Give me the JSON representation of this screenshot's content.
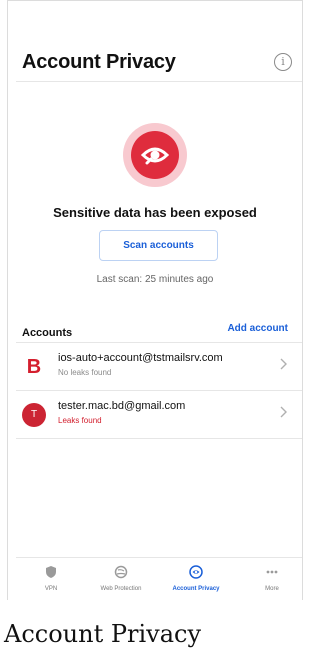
{
  "header": {
    "title": "Account Privacy"
  },
  "hero": {
    "headline": "Sensitive data has been exposed"
  },
  "scan": {
    "button_label": "Scan accounts",
    "last_scan": "Last scan: 25 minutes ago"
  },
  "accounts": {
    "title": "Accounts",
    "add_label": "Add account",
    "items": [
      {
        "avatar": "B",
        "email": "ios-auto+account@tstmailsrv.com",
        "status": "No leaks found",
        "status_color": "#8b8b8b"
      },
      {
        "avatar": "T",
        "email": "tester.mac.bd@gmail.com",
        "status": "Leaks found",
        "status_color": "#d21d2c"
      }
    ]
  },
  "tabs": [
    {
      "label": "VPN",
      "icon": "shield-icon",
      "active": false
    },
    {
      "label": "Web Protection",
      "icon": "globe-shield-icon",
      "active": false
    },
    {
      "label": "Account Privacy",
      "icon": "eye-icon",
      "active": true
    },
    {
      "label": "More",
      "icon": "more-dots-icon",
      "active": false
    }
  ],
  "colors": {
    "accent": "#1a5fd8",
    "danger": "#df2c3d",
    "danger_light": "#f8c9cf"
  },
  "page_label": "Account Privacy"
}
